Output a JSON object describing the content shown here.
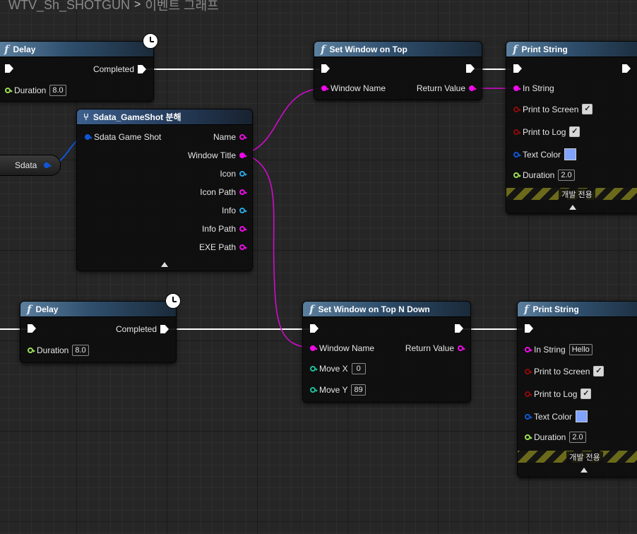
{
  "breadcrumb": {
    "blueprint": "WTV_Sh_SHOTGUN",
    "separator": ">",
    "graph": "이벤트 그래프"
  },
  "icons": {
    "function": "function-icon",
    "break_struct": "break-struct-icon",
    "latent": "clock-icon"
  },
  "colors": {
    "string_pin": "#f00be8",
    "bool_pin": "#8e0a0a",
    "struct_pin": "#0e57d6",
    "float_pin": "#9be052",
    "int_pin": "#1fbf9a",
    "texture_pin": "#2aa7e0",
    "color_swatch": "#7fa3ff"
  },
  "delay1": {
    "title": "Delay",
    "completed": "Completed",
    "duration_label": "Duration",
    "duration": "8.0"
  },
  "delay2": {
    "title": "Delay",
    "completed": "Completed",
    "duration_label": "Duration",
    "duration": "8.0"
  },
  "sdata_var": {
    "label": "Sdata"
  },
  "break_node": {
    "title": "Sdata_GameShot 분해",
    "input": "Sdata Game Shot",
    "outputs": [
      "Name",
      "Window Title",
      "Icon",
      "Icon Path",
      "Info",
      "Info Path",
      "EXE Path"
    ]
  },
  "set_top": {
    "title": "Set Window on Top",
    "window_name": "Window Name",
    "return_value": "Return Value"
  },
  "set_top_down": {
    "title": "Set Window on Top N Down",
    "window_name": "Window Name",
    "return_value": "Return Value",
    "move_x_label": "Move X",
    "move_x": "0",
    "move_y_label": "Move Y",
    "move_y": "89"
  },
  "print1": {
    "title": "Print String",
    "in_string": "In String",
    "print_screen": "Print to Screen",
    "print_log": "Print to Log",
    "text_color": "Text Color",
    "duration_label": "Duration",
    "duration": "2.0",
    "dev_only": "개발 전용",
    "check": "✓"
  },
  "print2": {
    "title": "Print String",
    "in_string": "In String",
    "in_string_value": "Hello",
    "print_screen": "Print to Screen",
    "print_log": "Print to Log",
    "text_color": "Text Color",
    "duration_label": "Duration",
    "duration": "2.0",
    "dev_only": "개발 전용",
    "check": "✓"
  }
}
